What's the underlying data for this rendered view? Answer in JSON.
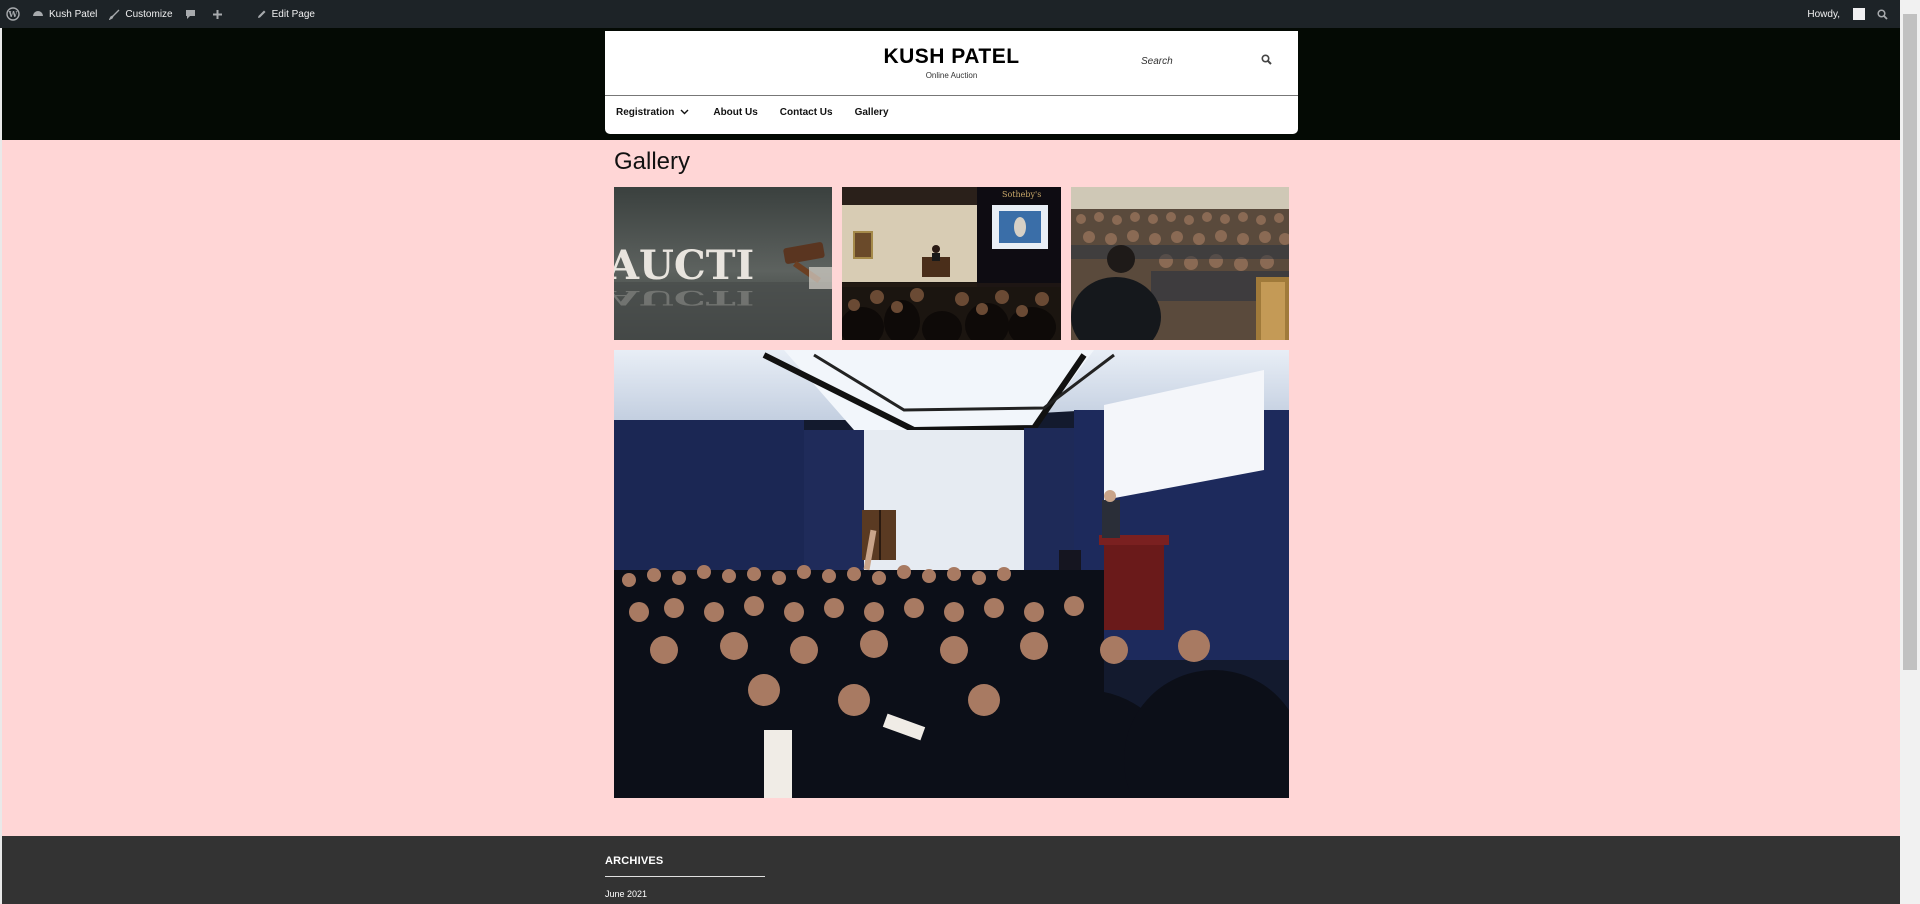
{
  "admin_bar": {
    "site_name": "Kush Patel",
    "customize": "Customize",
    "edit_page": "Edit Page",
    "howdy": "Howdy,"
  },
  "header": {
    "site_title": "KUSH PATEL",
    "site_description": "Online Auction",
    "search_placeholder": "Search"
  },
  "nav": {
    "items": [
      {
        "label": "Registration"
      },
      {
        "label": "About Us"
      },
      {
        "label": "Contact Us"
      },
      {
        "label": "Gallery"
      }
    ]
  },
  "main": {
    "page_title": "Gallery"
  },
  "footer": {
    "widget_title": "ARCHIVES",
    "archive_link": "June 2021"
  },
  "colors": {
    "admin_bar": "#1d2327",
    "header_band": "#040a04",
    "page_background": "#ffd6d6",
    "footer": "#333333"
  }
}
